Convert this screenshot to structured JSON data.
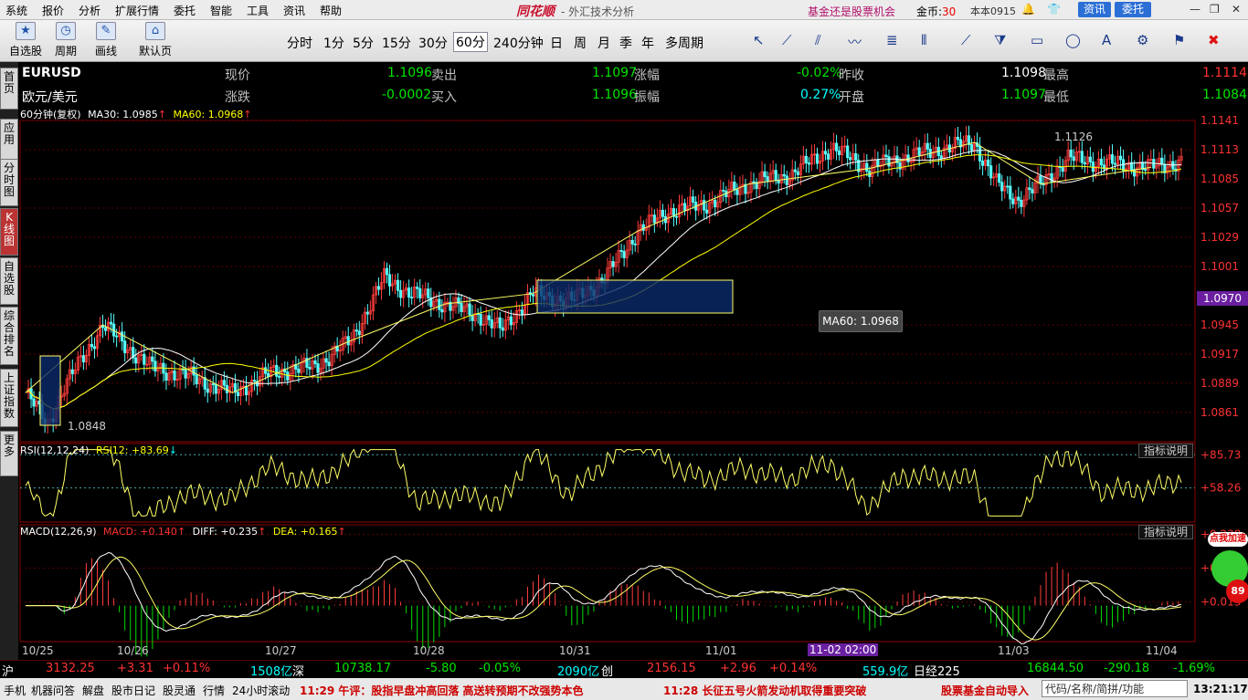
{
  "menu": [
    "系统",
    "报价",
    "分析",
    "扩展行情",
    "委托",
    "智能",
    "工具",
    "资讯",
    "帮助"
  ],
  "brand": "同花顺",
  "brand_sub": "- 外汇技术分析",
  "ad_text": "基金还是股票机会",
  "gold_label": "金币:",
  "gold_value": "30",
  "version": "本本0915",
  "btn_news": "资讯",
  "btn_trade": "委托",
  "toolbar_left": [
    {
      "label": "自选股",
      "icon": "star-icon"
    },
    {
      "label": "周期",
      "icon": "clock-icon"
    },
    {
      "label": "画线",
      "icon": "pencil-icon"
    },
    {
      "label": "默认页",
      "icon": "home-icon"
    }
  ],
  "periods": [
    "分时",
    "1分",
    "5分",
    "15分",
    "30分",
    "60分",
    "240分钟",
    "日",
    "周",
    "月",
    "季",
    "年",
    "多周期"
  ],
  "active_period": "60分",
  "left_nav": [
    "首页",
    "应用",
    "分时图",
    "K线图",
    "自选股",
    "综合排名",
    "上证指数",
    "更多"
  ],
  "quote": {
    "symbol": "EURUSD",
    "name": "欧元/美元",
    "rows": [
      [
        {
          "l": "现价",
          "v": "1.1096"
        },
        {
          "l": "卖出",
          "v": "1.1097"
        },
        {
          "l": "涨幅",
          "v": "-0.02%"
        },
        {
          "l": "昨收",
          "v": "1.1098"
        },
        {
          "l": "最高",
          "v": "1.1114"
        }
      ],
      [
        {
          "l": "涨跌",
          "v": "-0.0002"
        },
        {
          "l": "买入",
          "v": "1.1096"
        },
        {
          "l": "振幅",
          "v": "0.27%"
        },
        {
          "l": "开盘",
          "v": "1.1097"
        },
        {
          "l": "最低",
          "v": "1.1084"
        }
      ]
    ]
  },
  "main_legend": {
    "period": "60分钟(复权)",
    "ma30": "MA30: 1.0985",
    "ma60": "MA60: 1.0968"
  },
  "rsi_legend": {
    "name": "RSI(12,12,24)",
    "rsi12": "RSI12: +83.69"
  },
  "macd_legend": {
    "name": "MACD(12,26,9)",
    "macd": "MACD: +0.140",
    "diff": "DIFF: +0.235",
    "dea": "DEA: +0.165"
  },
  "indicator_btn": "指标说明",
  "tooltip": "MA60: 1.0968",
  "price_marks": {
    "high": "1.1126",
    "low": "1.0848"
  },
  "current_tag": "1.0970",
  "axis_date_highlight": "11-02 02:00",
  "chart_data": {
    "type": "candlestick",
    "price_axis": [
      1.1141,
      1.1113,
      1.1085,
      1.1057,
      1.1029,
      1.1001,
      1.0945,
      1.0917,
      1.0889,
      1.0861
    ],
    "rsi_axis": [
      85.73,
      58.26
    ],
    "macd_axis": [
      0.238,
      0.125,
      0.013
    ],
    "dates": [
      "10/25",
      "10/26",
      "10/27",
      "10/28",
      "10/31",
      "11/01",
      "11/03",
      "11/04"
    ],
    "anchors": [
      [
        0,
        1.088
      ],
      [
        8,
        1.085
      ],
      [
        14,
        1.0885
      ],
      [
        28,
        1.0945
      ],
      [
        45,
        1.0905
      ],
      [
        60,
        1.0895
      ],
      [
        75,
        1.088
      ],
      [
        90,
        1.09
      ],
      [
        105,
        1.0905
      ],
      [
        118,
        1.093
      ],
      [
        130,
        1.099
      ],
      [
        140,
        1.0975
      ],
      [
        152,
        1.0965
      ],
      [
        164,
        1.0955
      ],
      [
        172,
        1.094
      ],
      [
        184,
        1.0975
      ],
      [
        198,
        1.0968
      ],
      [
        210,
        1.099
      ],
      [
        222,
        1.1035
      ],
      [
        234,
        1.1055
      ],
      [
        246,
        1.106
      ],
      [
        262,
        1.108
      ],
      [
        278,
        1.109
      ],
      [
        292,
        1.1115
      ],
      [
        306,
        1.1095
      ],
      [
        318,
        1.1105
      ],
      [
        334,
        1.1115
      ],
      [
        344,
        1.112
      ],
      [
        352,
        1.108
      ],
      [
        360,
        1.1065
      ],
      [
        368,
        1.108
      ],
      [
        378,
        1.1105
      ],
      [
        392,
        1.11
      ],
      [
        408,
        1.1096
      ]
    ]
  },
  "status": [
    {
      "t": "沪",
      "c": "wh"
    },
    {
      "t": "3132.25",
      "c": "up"
    },
    {
      "t": "+3.31",
      "c": "up"
    },
    {
      "t": "+0.11%",
      "c": "up"
    },
    {
      "t": "1508亿",
      "c": "cy"
    },
    {
      "t": "深",
      "c": "wh"
    },
    {
      "t": "10738.17",
      "c": "dn"
    },
    {
      "t": "-5.80",
      "c": "dn"
    },
    {
      "t": "-0.05%",
      "c": "dn"
    },
    {
      "t": "2090亿",
      "c": "cy"
    },
    {
      "t": "创",
      "c": "wh"
    },
    {
      "t": "2156.15",
      "c": "up"
    },
    {
      "t": "+2.96",
      "c": "up"
    },
    {
      "t": "+0.14%",
      "c": "up"
    },
    {
      "t": "559.9亿",
      "c": "cy"
    },
    {
      "t": "日经225",
      "c": "wh"
    },
    {
      "t": "16844.50",
      "c": "dn"
    },
    {
      "t": "-290.18",
      "c": "dn"
    },
    {
      "t": "-1.69%",
      "c": "dn"
    }
  ],
  "ticker_tabs": [
    "手机",
    "机器问答",
    "解盘",
    "股市日记",
    "股灵通",
    "行情",
    "24小时滚动"
  ],
  "news1": "11:29 午评：股指早盘冲高回落 高送转预期不改强势本色",
  "news2": "11:28 长征五号火箭发动机取得重要突破",
  "news3": "股票基金自动导入",
  "search_placeholder": "代码/名称/简拼/功能",
  "clock": "13:21:17",
  "float_ad": "点我加速",
  "float_num": "89"
}
